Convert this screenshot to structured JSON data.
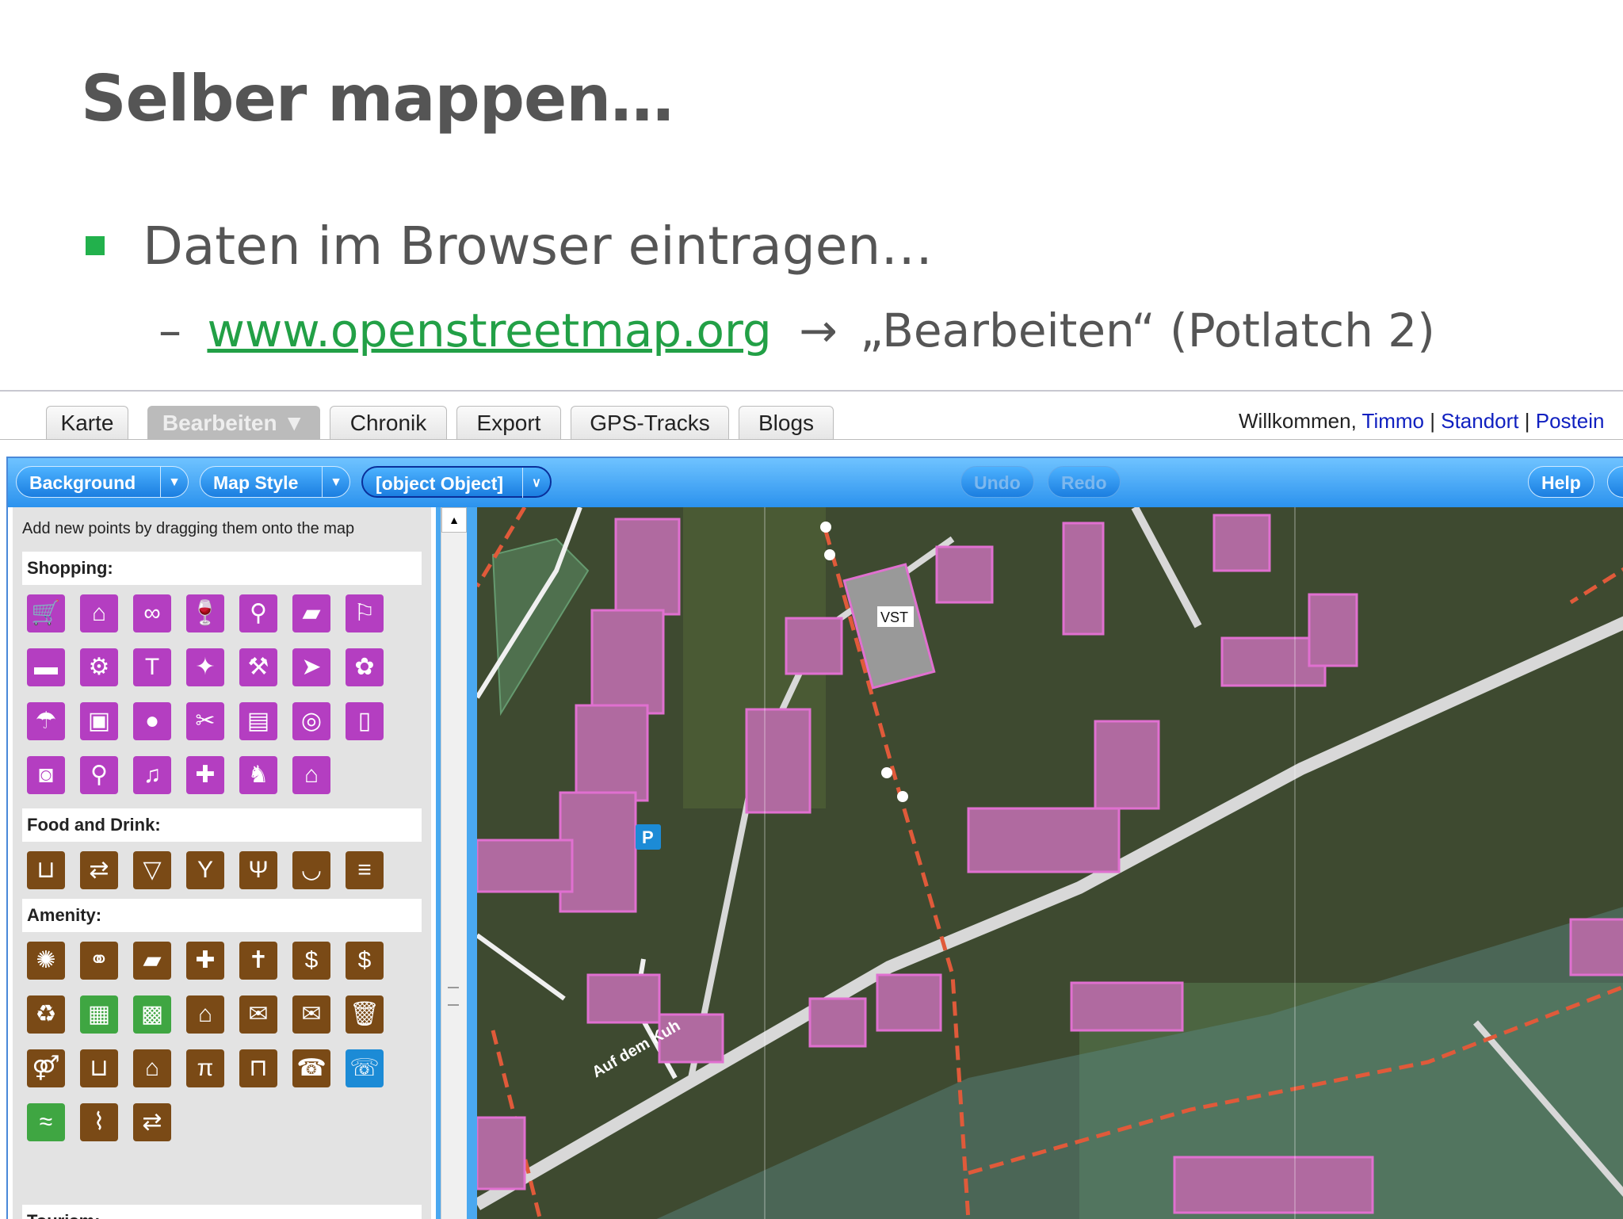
{
  "slide": {
    "title": "Selber mappen…",
    "bullet": "Daten im Browser eintragen…",
    "sub_dash": "–",
    "sub_link": "www.openstreetmap.org",
    "sub_arrow": "→",
    "sub_rest": "„Bearbeiten“ (Potlatch 2)"
  },
  "site": {
    "tabs": [
      "Karte",
      "Bearbeiten ▼",
      "Chronik",
      "Export",
      "GPS-Tracks",
      "Blogs"
    ],
    "active_tab": "Bearbeiten ▼",
    "welcome_prefix": "Willkommen, ",
    "user": "Timmo",
    "sep": " | ",
    "standort": "Standort",
    "posteingang": "Postein"
  },
  "toolbar": {
    "background": "Background",
    "map_style": "Map Style",
    "object": "[object Object]",
    "undo": "Undo",
    "redo": "Redo",
    "help": "Help"
  },
  "panel": {
    "hint": "Add new points by dragging them onto the map",
    "categories": [
      "Shopping:",
      "Food and Drink:",
      "Amenity:",
      "Tourism:"
    ],
    "shopping_icons": [
      "cart-icon",
      "basket-icon",
      "pretzel-icon",
      "wine-icon",
      "bicycle-icon",
      "book-icon",
      "butcher-icon",
      "car-icon",
      "car-repair-icon",
      "clothes-icon",
      "sweets-icon",
      "tools-icon",
      "fish-icon",
      "florist-icon",
      "garden-icon",
      "gift-icon",
      "greengrocer-icon",
      "hairdresser-icon",
      "hifi-icon",
      "jewellery-icon",
      "kiosk-icon",
      "laundry-icon",
      "motorbike-icon",
      "music-icon",
      "pharmacy-icon",
      "toys-icon",
      "market-icon"
    ],
    "food_icons": [
      "drinking-water-icon",
      "exchange-icon",
      "glass-icon",
      "cocktail-icon",
      "restaurant-icon",
      "cafe-icon",
      "fastfood-icon"
    ],
    "amenity_icons": [
      "fire-station-icon",
      "bureau-icon",
      "library-icon",
      "hospital-icon",
      "place-of-worship-icon",
      "bank-icon",
      "money-icon",
      "recycling-icon",
      "cinema-icon",
      "toy-box-icon",
      "house-icon",
      "post-box-icon",
      "post-office-icon",
      "bin-icon",
      "toilets-icon",
      "water-tap-icon",
      "shelter-icon",
      "picnic-table-icon",
      "bench-icon",
      "phone-icon",
      "phone-box-icon",
      "swimming-icon",
      "fountain-icon",
      "exchange-booth-icon"
    ],
    "scroll_up": "▲"
  },
  "map": {
    "labels": [
      "VST",
      "Auf dem Kuh"
    ],
    "colors": {
      "building": "#d46cc0",
      "boundary": "#e05a3a",
      "road": "#e8e8e8",
      "accent": "#2b92ee"
    }
  }
}
